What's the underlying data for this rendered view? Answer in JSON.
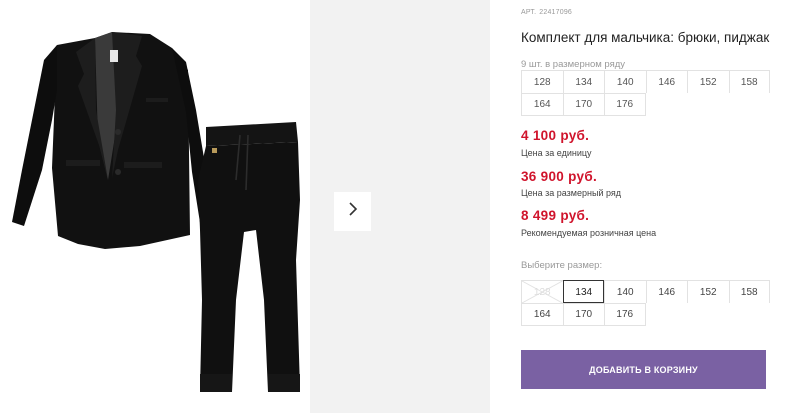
{
  "product": {
    "art_label": "АРТ.",
    "art_number": "22417096",
    "title": "Комплект для мальчика: брюки, пиджак",
    "pack_note": "9 шт. в размерном ряду",
    "pack_sizes": [
      "128",
      "134",
      "140",
      "146",
      "152",
      "158",
      "164",
      "170",
      "176"
    ]
  },
  "prices": {
    "unit_price": "4 100 руб.",
    "unit_label": "Цена за единицу",
    "pack_price": "36 900 руб.",
    "pack_label": "Цена за размерный ряд",
    "retail_price": "8 499 руб.",
    "retail_label": "Рекомендуемая розничная цена"
  },
  "size_picker": {
    "label": "Выберите размер:",
    "sizes": [
      "128",
      "134",
      "140",
      "146",
      "152",
      "158",
      "164",
      "170",
      "176"
    ],
    "selected": "134",
    "disabled": "128"
  },
  "actions": {
    "add_to_cart": "ДОБАВИТЬ В КОРЗИНУ"
  },
  "gallery": {
    "next_icon": "chevron-right-icon"
  },
  "colors": {
    "price": "#d0142c",
    "cart_button": "#7a61a3",
    "gallery_panel": "#f2f2f2"
  }
}
